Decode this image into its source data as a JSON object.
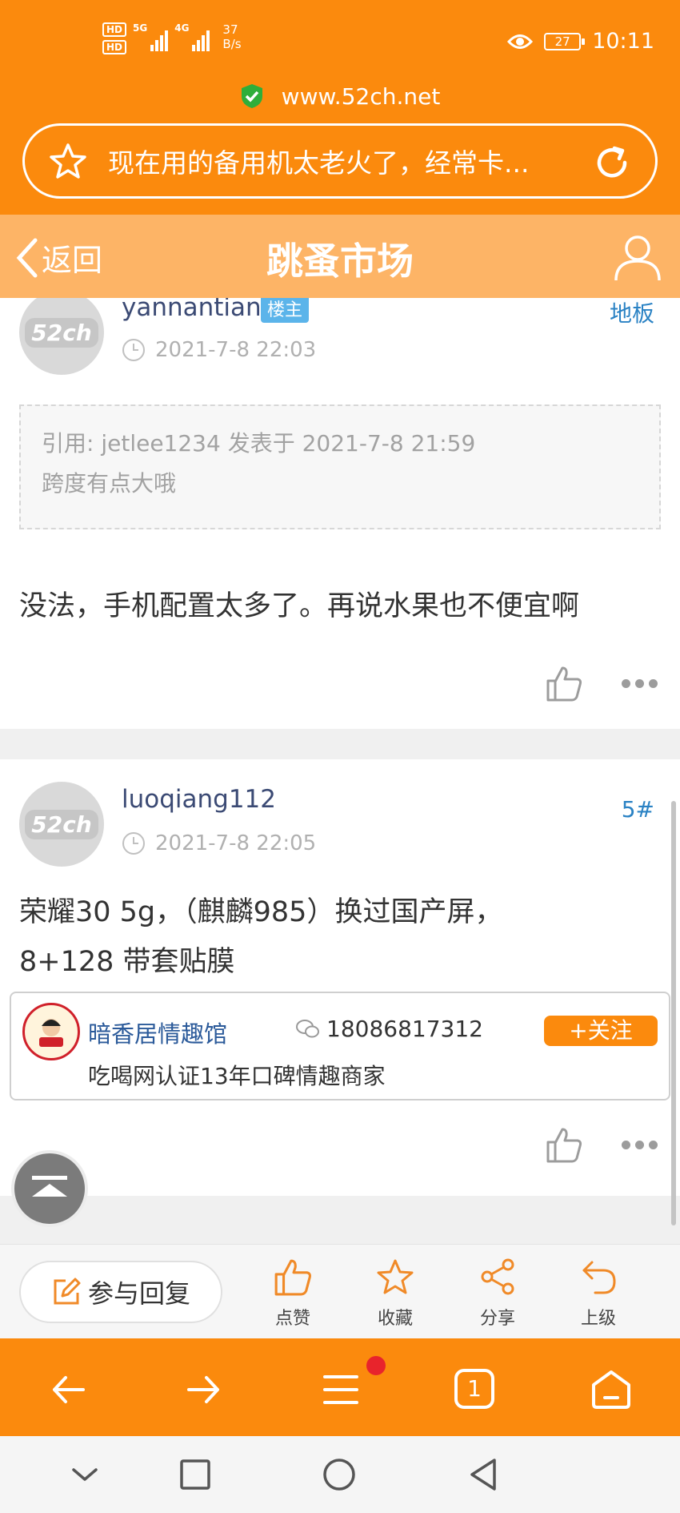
{
  "status_bar": {
    "hd1": "HD",
    "hd2": "HD",
    "signal1_label": "5G",
    "signal2_label": "4G",
    "speed_value": "37",
    "speed_unit": "B/s",
    "battery": "27",
    "time": "10:11"
  },
  "browser": {
    "url": "www.52ch.net",
    "search_text": "现在用的备用机太老火了，经常卡..."
  },
  "header": {
    "back_label": "返回",
    "title": "跳蚤市场"
  },
  "posts": [
    {
      "avatar_text": "52ch",
      "username": "yannantian",
      "badge": "楼主",
      "time": "2021-7-8 22:03",
      "floor": "地板",
      "quote_line1": "引用: jetlee1234 发表于 2021-7-8 21:59",
      "quote_line2": "跨度有点大哦",
      "content_line1": "没法，手机配置太多了。再说水果也不便宜啊"
    },
    {
      "avatar_text": "52ch",
      "username": "luoqiang112",
      "time": "2021-7-8 22:05",
      "floor": "5#",
      "content_line1": "荣耀30 5g，（麒麟985）换过国产屏，",
      "content_line2": "8+128  带套贴膜"
    }
  ],
  "ad": {
    "name": "暗香居情趣馆",
    "phone": "18086817312",
    "follow_label": "+关注",
    "desc": "吃喝网认证13年口碑情趣商家"
  },
  "reply_bar": {
    "reply_label": "参与回复",
    "like_label": "点赞",
    "favorite_label": "收藏",
    "share_label": "分享",
    "up_label": "上级"
  },
  "browser_nav": {
    "tab_count": "1"
  },
  "colors": {
    "accent": "#fb8a0d",
    "header": "#fdb466",
    "badge": "#5bb4ea",
    "link": "#3b4a74",
    "floor": "#2a82c4"
  }
}
